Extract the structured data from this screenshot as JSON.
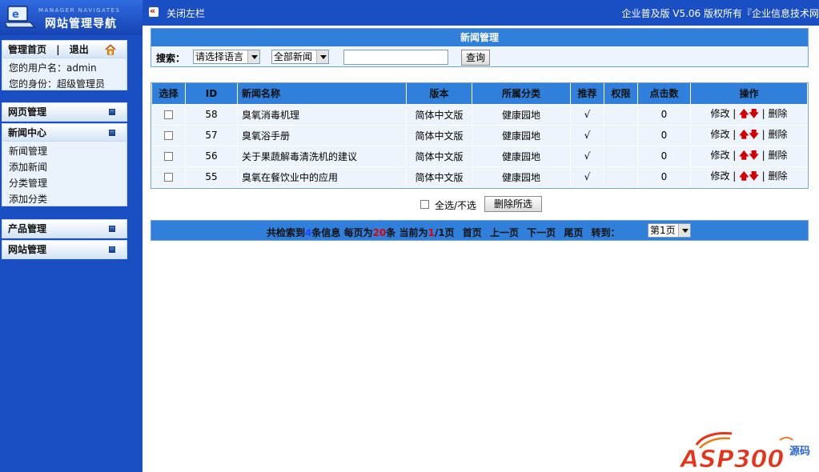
{
  "sidebar": {
    "logo_sub": "MANAGER NAVIGATES",
    "logo_main": "网站管理导航",
    "top": {
      "home_link": "管理首页",
      "separator": "|",
      "logout": "退出",
      "username_line": "您的用户名：admin",
      "role_line": "您的身份：超级管理员"
    },
    "sections": {
      "webpage": "网页管理",
      "news": "新闻中心",
      "product": "产品管理",
      "site": "网站管理"
    },
    "news_items": [
      "新闻管理",
      "添加新闻",
      "分类管理",
      "添加分类"
    ]
  },
  "topbar": {
    "close_left": "关闭左栏",
    "copyright": "企业普及版 V5.06  版权所有『企业信息技术网"
  },
  "search": {
    "title": "新闻管理",
    "label": "搜索：",
    "language_select": "请选择语言",
    "type_select": "全部新闻",
    "keyword": "",
    "button": "查询"
  },
  "table": {
    "headers": {
      "select": "选择",
      "id": "ID",
      "name": "新闻名称",
      "version": "版本",
      "category": "所属分类",
      "recommend": "推荐",
      "permission": "权限",
      "clicks": "点击数",
      "actions": "操作"
    },
    "rows": [
      {
        "id": "58",
        "name": "臭氧消毒机理",
        "version": "简体中文版",
        "category": "健康园地",
        "recommend": "√",
        "permission": "",
        "clicks": "0"
      },
      {
        "id": "57",
        "name": "臭氧浴手册",
        "version": "简体中文版",
        "category": "健康园地",
        "recommend": "√",
        "permission": "",
        "clicks": "0"
      },
      {
        "id": "56",
        "name": "关于果蔬解毒清洗机的建议",
        "version": "简体中文版",
        "category": "健康园地",
        "recommend": "√",
        "permission": "",
        "clicks": "0"
      },
      {
        "id": "55",
        "name": "臭氧在餐饮业中的应用",
        "version": "简体中文版",
        "category": "健康园地",
        "recommend": "√",
        "permission": "",
        "clicks": "0"
      }
    ],
    "action_edit": "修改",
    "action_sep": "|",
    "action_up": "🡅",
    "action_down": "🡇",
    "action_delete": "删除"
  },
  "bulk": {
    "select_all": "全选/不选",
    "delete_selected": "删除所选"
  },
  "pager": {
    "prefix": "共检索到",
    "total": "4",
    "total_suffix": "条信息  每页为",
    "per_page": "20",
    "per_page_suffix": "条  当前为",
    "current": "1",
    "pages": "/1页",
    "first": "首页",
    "prev": "上一页",
    "next": "下一页",
    "last": "尾页",
    "goto": "转到：",
    "page_select": "第1页"
  },
  "watermark": {
    "brand": "ASP300",
    "suffix": "源码"
  },
  "colors": {
    "sidebar_bg": "#1a4fc4",
    "header_blue": "#2f7fdb",
    "row_bg": "#eef4fb",
    "accent_red": "#e00000"
  }
}
